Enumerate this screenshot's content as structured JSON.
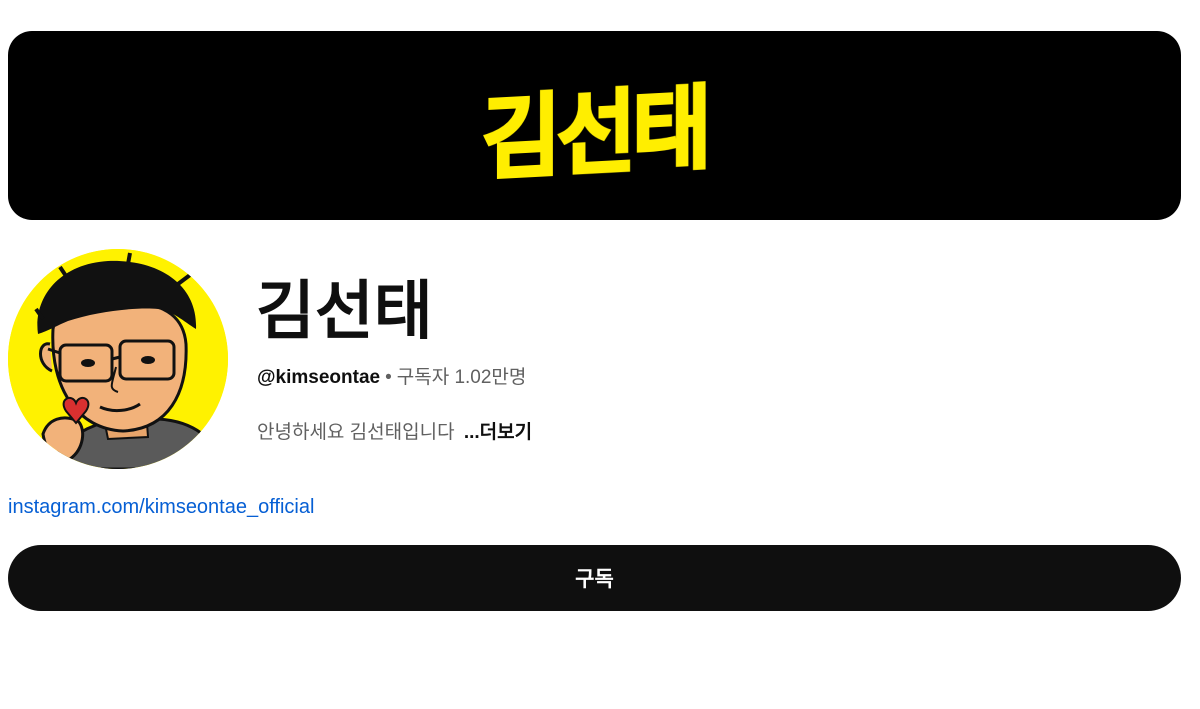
{
  "banner": {
    "logo_text": "김선태",
    "logo_color": "#ffee00",
    "background": "#000000"
  },
  "channel": {
    "name": "김선태",
    "handle": "@kimseontae",
    "separator": "•",
    "subscribers": "구독자 1.02만명",
    "description": "안녕하세요 김선태입니다",
    "more_label": "...더보기",
    "link_text": "instagram.com/kimseontae_official",
    "avatar_bg": "#fff200"
  },
  "actions": {
    "subscribe_label": "구독"
  },
  "colors": {
    "link": "#065fd4",
    "button": "#0f0f0f",
    "secondary_text": "#606060"
  }
}
